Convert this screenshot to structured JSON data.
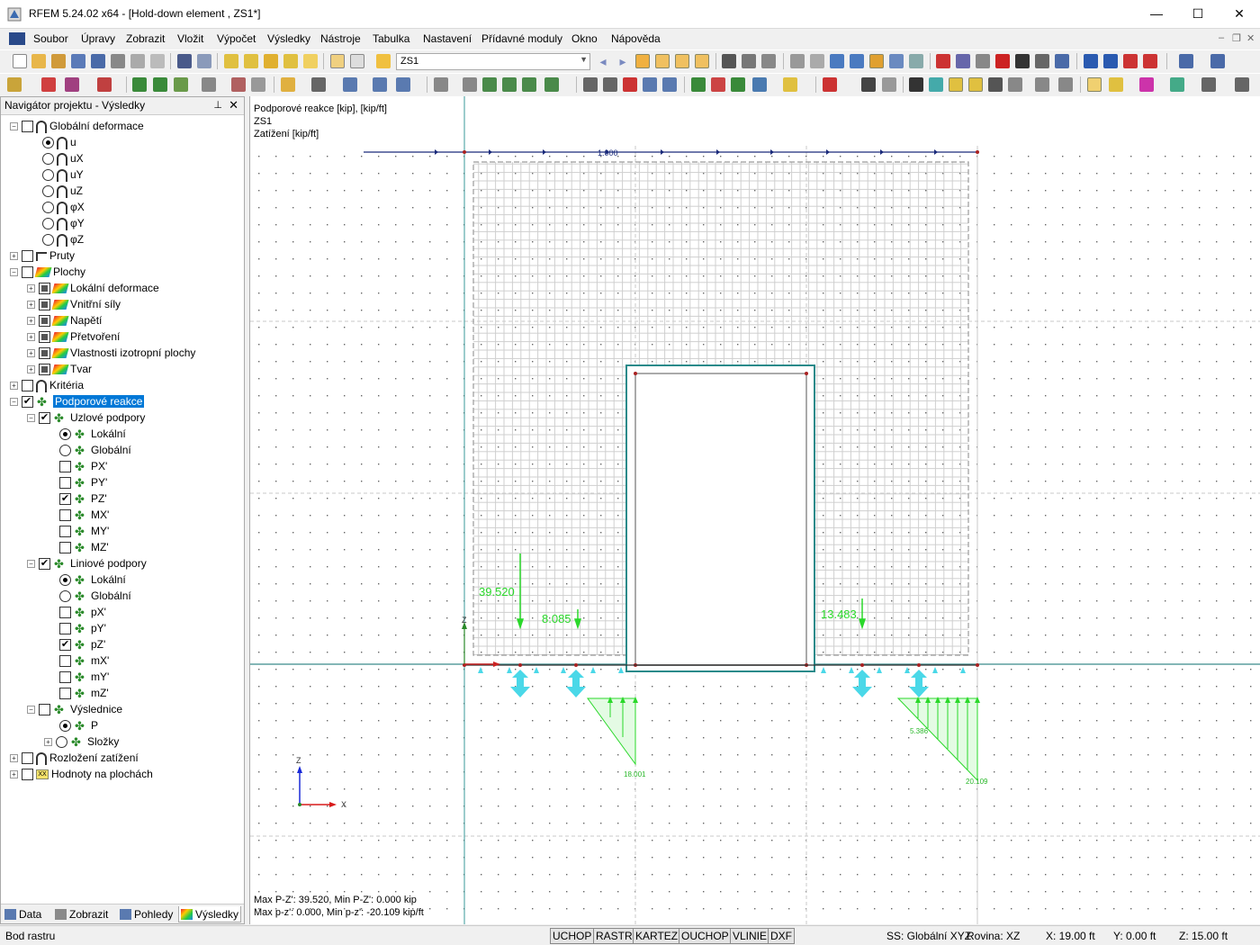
{
  "window": {
    "title": "RFEM 5.24.02 x64 - [Hold-down element , ZS1*]",
    "min": "—",
    "max": "☐",
    "close": "✕"
  },
  "menu": [
    "Soubor",
    "Úpravy",
    "Zobrazit",
    "Vložit",
    "Výpočet",
    "Výsledky",
    "Nástroje",
    "Tabulka",
    "Nastavení",
    "Přídavné moduly",
    "Okno",
    "Nápověda"
  ],
  "toolbar": {
    "loadcase_combo": "ZS1"
  },
  "navigator": {
    "title": "Navigátor projektu - Výsledky",
    "tree": [
      {
        "label": "Globální deformace"
      },
      {
        "label": "u"
      },
      {
        "label": "uX"
      },
      {
        "label": "uY"
      },
      {
        "label": "uZ"
      },
      {
        "label": "φX"
      },
      {
        "label": "φY"
      },
      {
        "label": "φZ"
      },
      {
        "label": "Pruty"
      },
      {
        "label": "Plochy"
      },
      {
        "label": "Lokální deformace"
      },
      {
        "label": "Vnitřní síly"
      },
      {
        "label": "Napětí"
      },
      {
        "label": "Přetvoření"
      },
      {
        "label": "Vlastnosti izotropní plochy"
      },
      {
        "label": "Tvar"
      },
      {
        "label": "Kritéria"
      },
      {
        "label": "Podporové reakce"
      },
      {
        "label": "Uzlové podpory"
      },
      {
        "label": "Lokální"
      },
      {
        "label": "Globální"
      },
      {
        "label": "PX'"
      },
      {
        "label": "PY'"
      },
      {
        "label": "PZ'"
      },
      {
        "label": "MX'"
      },
      {
        "label": "MY'"
      },
      {
        "label": "MZ'"
      },
      {
        "label": "Liniové podpory"
      },
      {
        "label": "Lokální"
      },
      {
        "label": "Globální"
      },
      {
        "label": "pX'"
      },
      {
        "label": "pY'"
      },
      {
        "label": "pZ'"
      },
      {
        "label": "mX'"
      },
      {
        "label": "mY'"
      },
      {
        "label": "mZ'"
      },
      {
        "label": "Výslednice"
      },
      {
        "label": "P"
      },
      {
        "label": "Složky"
      },
      {
        "label": "Rozložení zatížení"
      },
      {
        "label": "Hodnoty na plochách"
      }
    ],
    "tabs": [
      "Data",
      "Zobrazit",
      "Pohledy",
      "Výsledky"
    ]
  },
  "canvas": {
    "header": [
      "Podporové reakce [kip], [kip/ft]",
      "ZS1",
      "Zatížení [kip/ft]"
    ],
    "load_label": "1.000",
    "reactions": [
      "39.520",
      "8.085",
      "13.483"
    ],
    "line_values": [
      "18.001",
      "5.386",
      "20.109"
    ],
    "axis": {
      "z": "Z",
      "x": "X"
    },
    "footer": [
      "Max P-Z': 39.520, Min P-Z': 0.000 kip",
      "Max p-z': 0.000, Min p-z': -20.109 kip/ft"
    ]
  },
  "status": {
    "left": "Bod rastru",
    "buttons": [
      "UCHOP",
      "RASTR",
      "KARTEZ",
      "OUCHOP",
      "VLINIE",
      "DXF"
    ],
    "ss": "SS: Globální XYZ",
    "plane": "Rovina: XZ",
    "x": "X:  19.00 ft",
    "y": "Y:  0.00 ft",
    "z": "Z:  15.00 ft"
  }
}
